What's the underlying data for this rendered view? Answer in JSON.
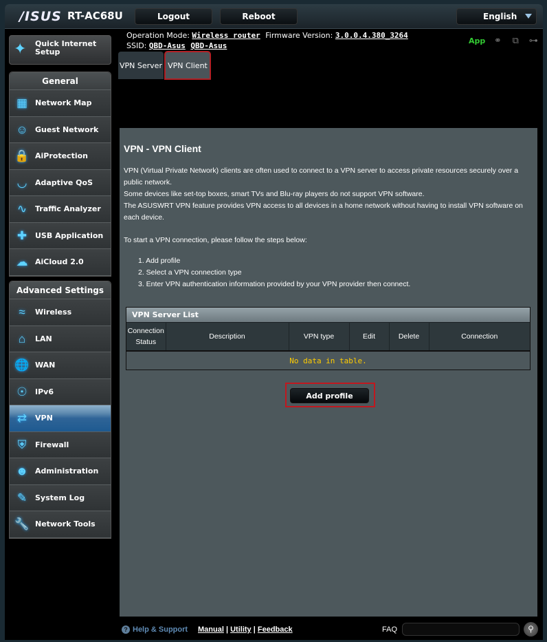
{
  "header": {
    "logo": "/ISUS",
    "model": "RT-AC68U",
    "logout_label": "Logout",
    "reboot_label": "Reboot",
    "language": "English"
  },
  "info": {
    "operation_mode_label": "Operation Mode:",
    "operation_mode_value": "Wireless router",
    "firmware_label": "Firmware Version:",
    "firmware_value": "3.0.0.4.380_3264",
    "ssid_label": "SSID:",
    "ssid_values": [
      "QBD-Asus",
      "QBD-Asus"
    ],
    "app_label": "App"
  },
  "tabs": [
    {
      "label": "VPN Server",
      "active": false
    },
    {
      "label": "VPN Client",
      "active": true
    }
  ],
  "sidebar": {
    "quick_setup": "Quick Internet Setup",
    "general": {
      "title": "General",
      "items": [
        {
          "label": "Network Map",
          "icon": "network-map-icon"
        },
        {
          "label": "Guest Network",
          "icon": "guest-network-icon"
        },
        {
          "label": "AiProtection",
          "icon": "lock-icon"
        },
        {
          "label": "Adaptive QoS",
          "icon": "gauge-icon"
        },
        {
          "label": "Traffic Analyzer",
          "icon": "traffic-chart-icon"
        },
        {
          "label": "USB Application",
          "icon": "puzzle-icon"
        },
        {
          "label": "AiCloud 2.0",
          "icon": "cloud-icon"
        }
      ]
    },
    "advanced": {
      "title": "Advanced Settings",
      "items": [
        {
          "label": "Wireless",
          "icon": "wifi-icon"
        },
        {
          "label": "LAN",
          "icon": "home-icon"
        },
        {
          "label": "WAN",
          "icon": "globe-icon"
        },
        {
          "label": "IPv6",
          "icon": "ipv6-globe-icon"
        },
        {
          "label": "VPN",
          "icon": "vpn-icon",
          "active": true
        },
        {
          "label": "Firewall",
          "icon": "shield-icon"
        },
        {
          "label": "Administration",
          "icon": "user-icon"
        },
        {
          "label": "System Log",
          "icon": "edit-log-icon"
        },
        {
          "label": "Network Tools",
          "icon": "wrench-icon"
        }
      ]
    }
  },
  "content": {
    "title": "VPN - VPN Client",
    "paragraphs": [
      "VPN (Virtual Private Network) clients are often used to connect to a VPN server to access private resources securely over a public network.",
      "Some devices like set-top boxes, smart TVs and Blu-ray players do not support VPN software.",
      "The ASUSWRT VPN feature provides VPN access to all devices in a home network without having to install VPN software on each device."
    ],
    "steps_intro": "To start a VPN connection, please follow the steps below:",
    "steps": [
      "1. Add profile",
      "2. Select a VPN connection type",
      "3. Enter VPN authentication information provided by your VPN provider then connect."
    ],
    "table": {
      "title": "VPN Server List",
      "columns": [
        "Connection Status",
        "Description",
        "VPN type",
        "Edit",
        "Delete",
        "Connection"
      ],
      "empty_message": "No data in table."
    },
    "add_profile_label": "Add profile"
  },
  "footer": {
    "help_label": "Help & Support",
    "links": [
      "Manual",
      "Utility",
      "Feedback"
    ],
    "faq_label": "FAQ",
    "faq_value": ""
  }
}
